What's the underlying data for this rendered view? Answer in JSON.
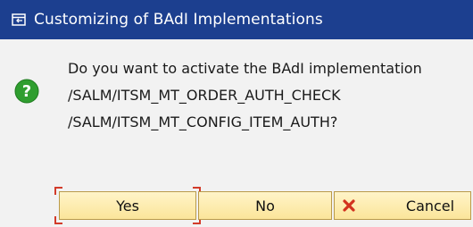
{
  "window": {
    "title": "Customizing of BAdI Implementations",
    "title_icon": "dialog-icon"
  },
  "message": {
    "icon": "question-icon",
    "lines": [
      "Do you want to activate the BAdI implementation",
      "/SALM/ITSM_MT_ORDER_AUTH_CHECK",
      "/SALM/ITSM_MT_CONFIG_ITEM_AUTH?"
    ]
  },
  "buttons": {
    "yes": "Yes",
    "no": "No",
    "cancel": "Cancel",
    "cancel_icon": "cancel-x-icon"
  },
  "colors": {
    "titlebar": "#1c3f8f",
    "button_bg": "#fbe59a",
    "question_icon": "#2f9e2f",
    "cancel_icon": "#d2321e",
    "focus": "#d23b2a"
  }
}
